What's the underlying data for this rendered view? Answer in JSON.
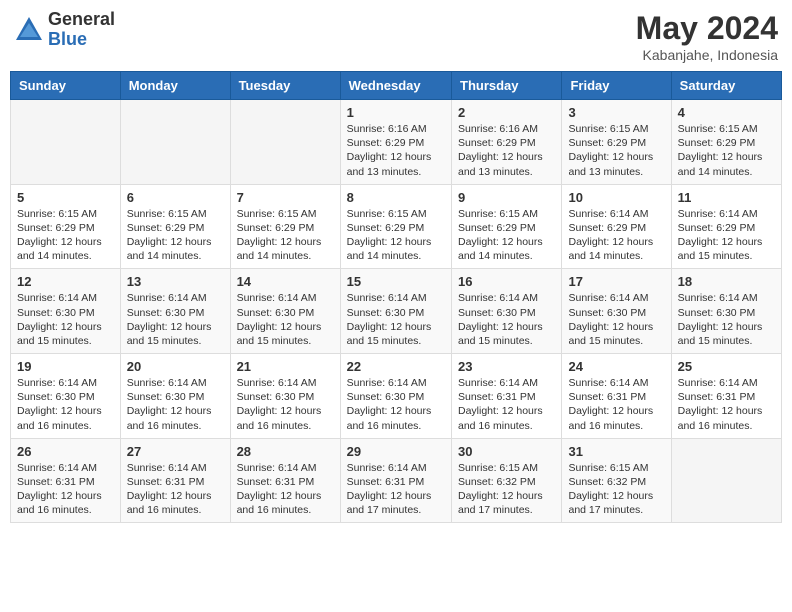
{
  "logo": {
    "general": "General",
    "blue": "Blue"
  },
  "header": {
    "month_year": "May 2024",
    "location": "Kabanjahe, Indonesia"
  },
  "weekdays": [
    "Sunday",
    "Monday",
    "Tuesday",
    "Wednesday",
    "Thursday",
    "Friday",
    "Saturday"
  ],
  "weeks": [
    [
      {
        "day": "",
        "content": ""
      },
      {
        "day": "",
        "content": ""
      },
      {
        "day": "",
        "content": ""
      },
      {
        "day": "1",
        "content": "Sunrise: 6:16 AM\nSunset: 6:29 PM\nDaylight: 12 hours and 13 minutes."
      },
      {
        "day": "2",
        "content": "Sunrise: 6:16 AM\nSunset: 6:29 PM\nDaylight: 12 hours and 13 minutes."
      },
      {
        "day": "3",
        "content": "Sunrise: 6:15 AM\nSunset: 6:29 PM\nDaylight: 12 hours and 13 minutes."
      },
      {
        "day": "4",
        "content": "Sunrise: 6:15 AM\nSunset: 6:29 PM\nDaylight: 12 hours and 14 minutes."
      }
    ],
    [
      {
        "day": "5",
        "content": "Sunrise: 6:15 AM\nSunset: 6:29 PM\nDaylight: 12 hours and 14 minutes."
      },
      {
        "day": "6",
        "content": "Sunrise: 6:15 AM\nSunset: 6:29 PM\nDaylight: 12 hours and 14 minutes."
      },
      {
        "day": "7",
        "content": "Sunrise: 6:15 AM\nSunset: 6:29 PM\nDaylight: 12 hours and 14 minutes."
      },
      {
        "day": "8",
        "content": "Sunrise: 6:15 AM\nSunset: 6:29 PM\nDaylight: 12 hours and 14 minutes."
      },
      {
        "day": "9",
        "content": "Sunrise: 6:15 AM\nSunset: 6:29 PM\nDaylight: 12 hours and 14 minutes."
      },
      {
        "day": "10",
        "content": "Sunrise: 6:14 AM\nSunset: 6:29 PM\nDaylight: 12 hours and 14 minutes."
      },
      {
        "day": "11",
        "content": "Sunrise: 6:14 AM\nSunset: 6:29 PM\nDaylight: 12 hours and 15 minutes."
      }
    ],
    [
      {
        "day": "12",
        "content": "Sunrise: 6:14 AM\nSunset: 6:30 PM\nDaylight: 12 hours and 15 minutes."
      },
      {
        "day": "13",
        "content": "Sunrise: 6:14 AM\nSunset: 6:30 PM\nDaylight: 12 hours and 15 minutes."
      },
      {
        "day": "14",
        "content": "Sunrise: 6:14 AM\nSunset: 6:30 PM\nDaylight: 12 hours and 15 minutes."
      },
      {
        "day": "15",
        "content": "Sunrise: 6:14 AM\nSunset: 6:30 PM\nDaylight: 12 hours and 15 minutes."
      },
      {
        "day": "16",
        "content": "Sunrise: 6:14 AM\nSunset: 6:30 PM\nDaylight: 12 hours and 15 minutes."
      },
      {
        "day": "17",
        "content": "Sunrise: 6:14 AM\nSunset: 6:30 PM\nDaylight: 12 hours and 15 minutes."
      },
      {
        "day": "18",
        "content": "Sunrise: 6:14 AM\nSunset: 6:30 PM\nDaylight: 12 hours and 15 minutes."
      }
    ],
    [
      {
        "day": "19",
        "content": "Sunrise: 6:14 AM\nSunset: 6:30 PM\nDaylight: 12 hours and 16 minutes."
      },
      {
        "day": "20",
        "content": "Sunrise: 6:14 AM\nSunset: 6:30 PM\nDaylight: 12 hours and 16 minutes."
      },
      {
        "day": "21",
        "content": "Sunrise: 6:14 AM\nSunset: 6:30 PM\nDaylight: 12 hours and 16 minutes."
      },
      {
        "day": "22",
        "content": "Sunrise: 6:14 AM\nSunset: 6:30 PM\nDaylight: 12 hours and 16 minutes."
      },
      {
        "day": "23",
        "content": "Sunrise: 6:14 AM\nSunset: 6:31 PM\nDaylight: 12 hours and 16 minutes."
      },
      {
        "day": "24",
        "content": "Sunrise: 6:14 AM\nSunset: 6:31 PM\nDaylight: 12 hours and 16 minutes."
      },
      {
        "day": "25",
        "content": "Sunrise: 6:14 AM\nSunset: 6:31 PM\nDaylight: 12 hours and 16 minutes."
      }
    ],
    [
      {
        "day": "26",
        "content": "Sunrise: 6:14 AM\nSunset: 6:31 PM\nDaylight: 12 hours and 16 minutes."
      },
      {
        "day": "27",
        "content": "Sunrise: 6:14 AM\nSunset: 6:31 PM\nDaylight: 12 hours and 16 minutes."
      },
      {
        "day": "28",
        "content": "Sunrise: 6:14 AM\nSunset: 6:31 PM\nDaylight: 12 hours and 16 minutes."
      },
      {
        "day": "29",
        "content": "Sunrise: 6:14 AM\nSunset: 6:31 PM\nDaylight: 12 hours and 17 minutes."
      },
      {
        "day": "30",
        "content": "Sunrise: 6:15 AM\nSunset: 6:32 PM\nDaylight: 12 hours and 17 minutes."
      },
      {
        "day": "31",
        "content": "Sunrise: 6:15 AM\nSunset: 6:32 PM\nDaylight: 12 hours and 17 minutes."
      },
      {
        "day": "",
        "content": ""
      }
    ]
  ]
}
